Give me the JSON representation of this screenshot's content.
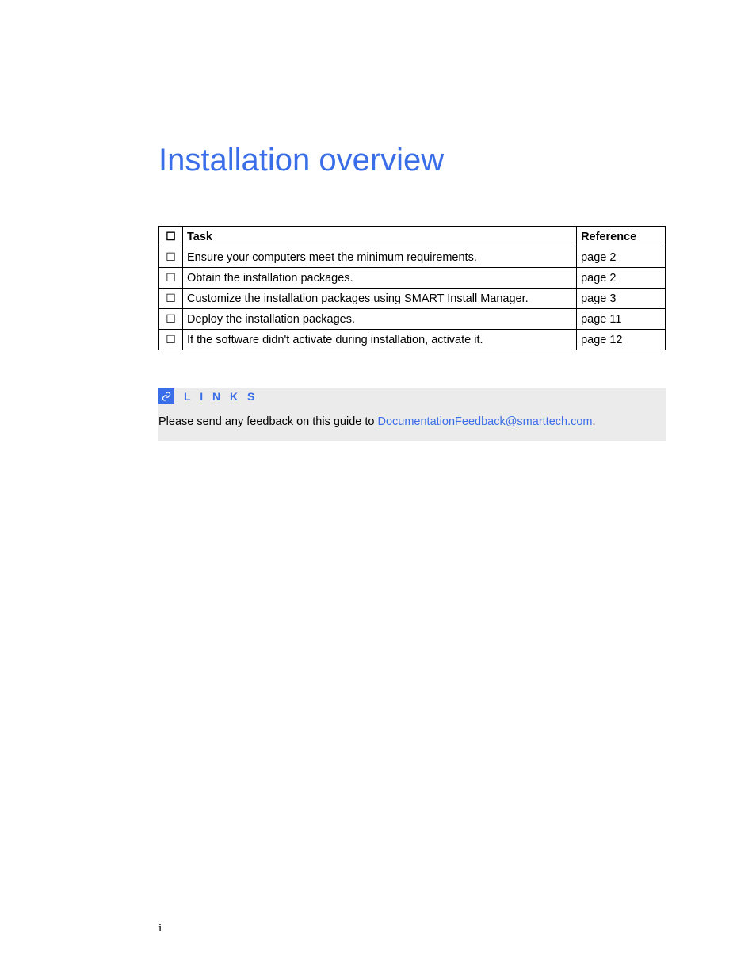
{
  "title": "Installation overview",
  "table": {
    "headers": {
      "checkbox": "☐",
      "task": "Task",
      "reference": "Reference"
    },
    "rows": [
      {
        "checkbox": "☐",
        "task": "Ensure your computers meet the minimum requirements.",
        "reference": "page 2"
      },
      {
        "checkbox": "☐",
        "task": "Obtain the installation packages.",
        "reference": "page 2"
      },
      {
        "checkbox": "☐",
        "task": "Customize the installation packages using SMART Install Manager.",
        "reference": "page 3"
      },
      {
        "checkbox": "☐",
        "task": "Deploy the installation packages.",
        "reference": "page 11"
      },
      {
        "checkbox": "☐",
        "task": "If the software didn't activate during installation, activate it.",
        "reference": "page 12"
      }
    ]
  },
  "links": {
    "heading": "L I N K S",
    "body_prefix": "Please send any feedback on this guide to ",
    "link_text": "DocumentationFeedback@smarttech.com",
    "body_suffix": "."
  },
  "page_number": "i"
}
